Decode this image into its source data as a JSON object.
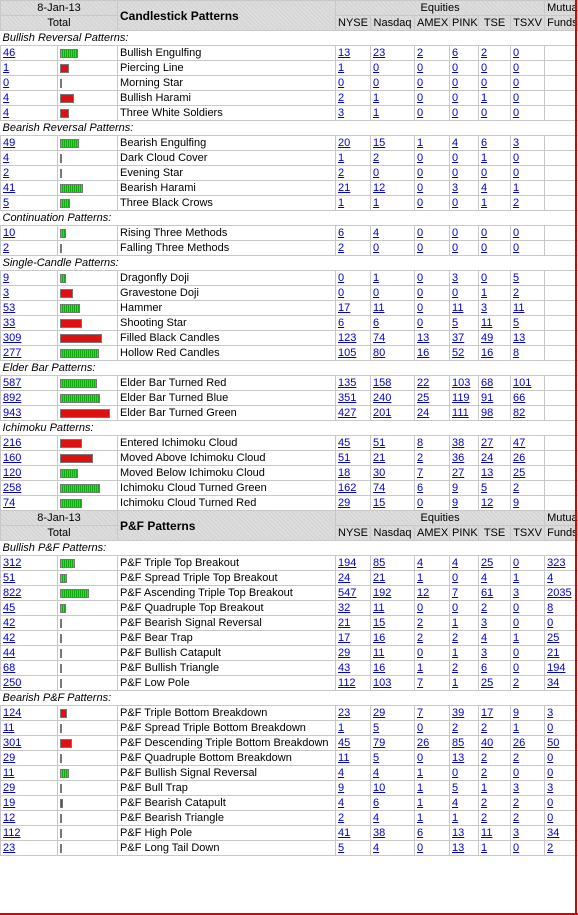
{
  "colors": {
    "green": "#22cc22",
    "red": "#dd1111",
    "link": "#0000cc"
  },
  "sections": [
    {
      "date": "8-Jan-13",
      "total_label": "Total",
      "title": "Candlestick Patterns",
      "equities_label": "Equities",
      "mutual_label_1": "Mutual",
      "mutual_label_2": "Funds",
      "exchanges": [
        "NYSE",
        "Nasdaq",
        "AMEX",
        "PINK",
        "TSE",
        "TSXV"
      ],
      "groups": [
        {
          "name": "Bullish Reversal Patterns:",
          "rows": [
            {
              "total": "46",
              "bar": "green",
              "level": 0.16,
              "name": "Bullish Engulfing",
              "vals": [
                "13",
                "23",
                "2",
                "6",
                "2",
                "0"
              ],
              "mf": ""
            },
            {
              "total": "1",
              "bar": "red",
              "level": 0.08,
              "name": "Piercing Line",
              "vals": [
                "1",
                "0",
                "0",
                "0",
                "0",
                "0"
              ],
              "mf": ""
            },
            {
              "total": "0",
              "bar": "green",
              "level": 0.02,
              "name": "Morning Star",
              "vals": [
                "0",
                "0",
                "0",
                "0",
                "0",
                "0"
              ],
              "mf": ""
            },
            {
              "total": "4",
              "bar": "red",
              "level": 0.13,
              "name": "Bullish Harami",
              "vals": [
                "2",
                "1",
                "0",
                "0",
                "1",
                "0"
              ],
              "mf": ""
            },
            {
              "total": "4",
              "bar": "red",
              "level": 0.08,
              "name": "Three White Soldiers",
              "vals": [
                "3",
                "1",
                "0",
                "0",
                "0",
                "0"
              ],
              "mf": ""
            }
          ]
        },
        {
          "name": "Bearish Reversal Patterns:",
          "rows": [
            {
              "total": "49",
              "bar": "green",
              "level": 0.17,
              "name": "Bearish Engulfing",
              "vals": [
                "20",
                "15",
                "1",
                "4",
                "6",
                "3"
              ],
              "mf": ""
            },
            {
              "total": "4",
              "bar": "red",
              "level": 0.02,
              "name": "Dark Cloud Cover",
              "vals": [
                "1",
                "2",
                "0",
                "0",
                "1",
                "0"
              ],
              "mf": ""
            },
            {
              "total": "2",
              "bar": "green",
              "level": 0.02,
              "name": "Evening Star",
              "vals": [
                "2",
                "0",
                "0",
                "0",
                "0",
                "0"
              ],
              "mf": ""
            },
            {
              "total": "41",
              "bar": "green",
              "level": 0.21,
              "name": "Bearish Harami",
              "vals": [
                "21",
                "12",
                "0",
                "3",
                "4",
                "1"
              ],
              "mf": ""
            },
            {
              "total": "5",
              "bar": "green",
              "level": 0.09,
              "name": "Three Black Crows",
              "vals": [
                "1",
                "1",
                "0",
                "0",
                "1",
                "2"
              ],
              "mf": ""
            }
          ]
        },
        {
          "name": "Continuation Patterns:",
          "rows": [
            {
              "total": "10",
              "bar": "green",
              "level": 0.05,
              "name": "Rising Three Methods",
              "vals": [
                "6",
                "4",
                "0",
                "0",
                "0",
                "0"
              ],
              "mf": ""
            },
            {
              "total": "2",
              "bar": "green",
              "level": 0.02,
              "name": "Falling Three Methods",
              "vals": [
                "2",
                "0",
                "0",
                "0",
                "0",
                "0"
              ],
              "mf": ""
            }
          ]
        },
        {
          "name": "Single-Candle Patterns:",
          "rows": [
            {
              "total": "9",
              "bar": "green",
              "level": 0.05,
              "name": "Dragonfly Doji",
              "vals": [
                "0",
                "1",
                "0",
                "3",
                "0",
                "5"
              ],
              "mf": ""
            },
            {
              "total": "3",
              "bar": "red",
              "level": 0.12,
              "name": "Gravestone Doji",
              "vals": [
                "0",
                "0",
                "0",
                "0",
                "1",
                "2"
              ],
              "mf": ""
            },
            {
              "total": "53",
              "bar": "green",
              "level": 0.18,
              "name": "Hammer",
              "vals": [
                "17",
                "11",
                "0",
                "11",
                "3",
                "11"
              ],
              "mf": ""
            },
            {
              "total": "33",
              "bar": "red",
              "level": 0.2,
              "name": "Shooting Star",
              "vals": [
                "6",
                "6",
                "0",
                "5",
                "11",
                "5"
              ],
              "mf": ""
            },
            {
              "total": "309",
              "bar": "red",
              "level": 0.38,
              "name": "Filled Black Candles",
              "vals": [
                "123",
                "74",
                "13",
                "37",
                "49",
                "13"
              ],
              "mf": ""
            },
            {
              "total": "277",
              "bar": "green",
              "level": 0.35,
              "name": "Hollow Red Candles",
              "vals": [
                "105",
                "80",
                "16",
                "52",
                "16",
                "8"
              ],
              "mf": ""
            }
          ]
        },
        {
          "name": "Elder Bar Patterns:",
          "rows": [
            {
              "total": "587",
              "bar": "green",
              "level": 0.34,
              "name": "Elder Bar Turned Red",
              "vals": [
                "135",
                "158",
                "22",
                "103",
                "68",
                "101"
              ],
              "mf": ""
            },
            {
              "total": "892",
              "bar": "green",
              "level": 0.36,
              "name": "Elder Bar Turned Blue",
              "vals": [
                "351",
                "240",
                "25",
                "119",
                "91",
                "66"
              ],
              "mf": ""
            },
            {
              "total": "943",
              "bar": "red",
              "level": 0.45,
              "name": "Elder Bar Turned Green",
              "vals": [
                "427",
                "201",
                "24",
                "111",
                "98",
                "82"
              ],
              "mf": ""
            }
          ]
        },
        {
          "name": "Ichimoku Patterns:",
          "rows": [
            {
              "total": "216",
              "bar": "red",
              "level": 0.2,
              "name": "Entered Ichimoku Cloud",
              "vals": [
                "45",
                "51",
                "8",
                "38",
                "27",
                "47"
              ],
              "mf": ""
            },
            {
              "total": "160",
              "bar": "red",
              "level": 0.3,
              "name": "Moved Above Ichimoku Cloud",
              "vals": [
                "51",
                "21",
                "2",
                "36",
                "24",
                "26"
              ],
              "mf": ""
            },
            {
              "total": "120",
              "bar": "green",
              "level": 0.16,
              "name": "Moved Below Ichimoku Cloud",
              "vals": [
                "18",
                "30",
                "7",
                "27",
                "13",
                "25"
              ],
              "mf": ""
            },
            {
              "total": "258",
              "bar": "green",
              "level": 0.36,
              "name": "Ichimoku Cloud Turned Green",
              "vals": [
                "162",
                "74",
                "6",
                "9",
                "5",
                "2"
              ],
              "mf": ""
            },
            {
              "total": "74",
              "bar": "green",
              "level": 0.2,
              "name": "Ichimoku Cloud Turned Red",
              "vals": [
                "29",
                "15",
                "0",
                "9",
                "12",
                "9"
              ],
              "mf": ""
            }
          ]
        }
      ]
    },
    {
      "date": "8-Jan-13",
      "total_label": "Total",
      "title": "P&F Patterns",
      "equities_label": "Equities",
      "mutual_label_1": "Mutual",
      "mutual_label_2": "Funds",
      "exchanges": [
        "NYSE",
        "Nasdaq",
        "AMEX",
        "PINK",
        "TSE",
        "TSXV"
      ],
      "groups": [
        {
          "name": "Bullish P&F Patterns:",
          "rows": [
            {
              "total": "312",
              "bar": "green",
              "level": 0.14,
              "name": "P&F Triple Top Breakout",
              "vals": [
                "194",
                "85",
                "4",
                "4",
                "25",
                "0"
              ],
              "mf": "323"
            },
            {
              "total": "51",
              "bar": "green",
              "level": 0.06,
              "name": "P&F Spread Triple Top Breakout",
              "vals": [
                "24",
                "21",
                "1",
                "0",
                "4",
                "1"
              ],
              "mf": "4"
            },
            {
              "total": "822",
              "bar": "green",
              "level": 0.26,
              "name": "P&F Ascending Triple Top Breakout",
              "vals": [
                "547",
                "192",
                "12",
                "7",
                "61",
                "3"
              ],
              "mf": "2035"
            },
            {
              "total": "45",
              "bar": "green",
              "level": 0.05,
              "name": "P&F Quadruple Top Breakout",
              "vals": [
                "32",
                "11",
                "0",
                "0",
                "2",
                "0"
              ],
              "mf": "8"
            },
            {
              "total": "42",
              "bar": "green",
              "level": 0.02,
              "name": "P&F Bearish Signal Reversal",
              "vals": [
                "21",
                "15",
                "2",
                "1",
                "3",
                "0"
              ],
              "mf": "0"
            },
            {
              "total": "42",
              "bar": "green",
              "level": 0.02,
              "name": "P&F Bear Trap",
              "vals": [
                "17",
                "16",
                "2",
                "2",
                "4",
                "1"
              ],
              "mf": "25"
            },
            {
              "total": "44",
              "bar": "green",
              "level": 0.02,
              "name": "P&F Bullish Catapult",
              "vals": [
                "29",
                "11",
                "0",
                "1",
                "3",
                "0"
              ],
              "mf": "21"
            },
            {
              "total": "68",
              "bar": "green",
              "level": 0.02,
              "name": "P&F Bullish Triangle",
              "vals": [
                "43",
                "16",
                "1",
                "2",
                "6",
                "0"
              ],
              "mf": "194"
            },
            {
              "total": "250",
              "bar": "green",
              "level": 0.02,
              "name": "P&F Low Pole",
              "vals": [
                "112",
                "103",
                "7",
                "1",
                "25",
                "2"
              ],
              "mf": "34"
            }
          ]
        },
        {
          "name": "Bearish P&F Patterns:",
          "rows": [
            {
              "total": "124",
              "bar": "red",
              "level": 0.06,
              "name": "P&F Triple Bottom Breakdown",
              "vals": [
                "23",
                "29",
                "7",
                "39",
                "17",
                "9"
              ],
              "mf": "3"
            },
            {
              "total": "11",
              "bar": "green",
              "level": 0.02,
              "name": "P&F Spread Triple Bottom Breakdown",
              "vals": [
                "1",
                "5",
                "0",
                "2",
                "2",
                "1"
              ],
              "mf": "0"
            },
            {
              "total": "301",
              "bar": "red",
              "level": 0.11,
              "name": "P&F Descending Triple Bottom Breakdown",
              "vals": [
                "45",
                "79",
                "26",
                "85",
                "40",
                "26"
              ],
              "mf": "50"
            },
            {
              "total": "29",
              "bar": "green",
              "level": 0.02,
              "name": "P&F Quadruple Bottom Breakdown",
              "vals": [
                "11",
                "5",
                "0",
                "13",
                "2",
                "2"
              ],
              "mf": "0"
            },
            {
              "total": "11",
              "bar": "green",
              "level": 0.08,
              "name": "P&F Bullish Signal Reversal",
              "vals": [
                "4",
                "4",
                "1",
                "0",
                "2",
                "0"
              ],
              "mf": "0"
            },
            {
              "total": "29",
              "bar": "green",
              "level": 0.02,
              "name": "P&F Bull Trap",
              "vals": [
                "9",
                "10",
                "1",
                "5",
                "1",
                "3"
              ],
              "mf": "3"
            },
            {
              "total": "19",
              "bar": "red",
              "level": 0.03,
              "name": "P&F Bearish Catapult",
              "vals": [
                "4",
                "6",
                "1",
                "4",
                "2",
                "2"
              ],
              "mf": "0"
            },
            {
              "total": "12",
              "bar": "green",
              "level": 0.02,
              "name": "P&F Bearish Triangle",
              "vals": [
                "2",
                "4",
                "1",
                "1",
                "2",
                "2"
              ],
              "mf": "0"
            },
            {
              "total": "112",
              "bar": "green",
              "level": 0.02,
              "name": "P&F High Pole",
              "vals": [
                "41",
                "38",
                "6",
                "13",
                "11",
                "3"
              ],
              "mf": "34"
            },
            {
              "total": "23",
              "bar": "green",
              "level": 0.02,
              "name": "P&F Long Tail Down",
              "vals": [
                "5",
                "4",
                "0",
                "13",
                "1",
                "0"
              ],
              "mf": "2"
            }
          ]
        }
      ]
    }
  ]
}
